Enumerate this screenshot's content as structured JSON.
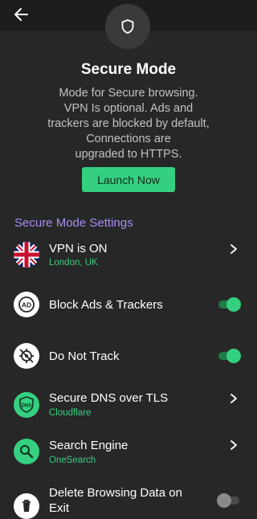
{
  "header": {
    "title": "Secure Mode"
  },
  "description": "Mode for Secure browsing. VPN Is optional. Ads and trackers are blocked by default, Connections are upgraded to HTTPS.",
  "description_lines": [
    "Mode for Secure browsing.",
    "VPN Is optional. Ads and",
    "trackers are blocked by default,",
    "Connections are",
    "upgraded to HTTPS."
  ],
  "launch_button": "Launch Now",
  "section_title": "Secure Mode Settings",
  "settings": {
    "vpn": {
      "label": "VPN is ON",
      "sub": "London, UK",
      "icon": "uk-flag-icon"
    },
    "block_ads": {
      "label": "Block Ads & Trackers",
      "toggle": true,
      "icon": "ad-block-icon"
    },
    "dnt": {
      "label": "Do Not Track",
      "toggle": true,
      "icon": "do-not-track-icon"
    },
    "dns": {
      "label": "Secure DNS over TLS",
      "sub": "Cloudflare",
      "icon": "dns-shield-icon"
    },
    "search": {
      "label": "Search Engine",
      "sub": "OneSearch",
      "icon": "search-icon"
    },
    "delete_data": {
      "label_line1": "Delete Browsing Data on",
      "label_line2": "Exit",
      "toggle": false,
      "icon": "trash-icon"
    }
  },
  "colors": {
    "background": "#272727",
    "accent_green": "#35d07f",
    "section_purple": "#a98df5",
    "muted_text": "#c2c2c2"
  }
}
